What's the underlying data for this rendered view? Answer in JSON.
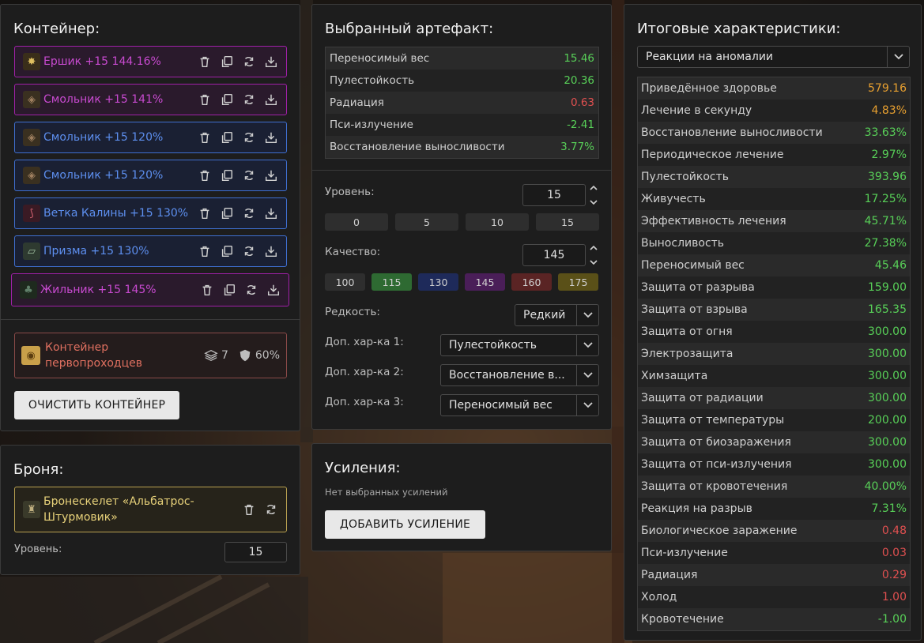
{
  "container": {
    "title": "Контейнер:",
    "items": [
      {
        "label": "Ершик +15 144.16%",
        "style": "purple",
        "icon": "spiky-artifact-icon"
      },
      {
        "label": "Смольник +15 141%",
        "style": "purple",
        "icon": "resin-artifact-icon"
      },
      {
        "label": "Смольник +15 120%",
        "style": "blue",
        "icon": "resin-artifact-icon"
      },
      {
        "label": "Смольник +15 120%",
        "style": "blue",
        "icon": "resin-artifact-icon"
      },
      {
        "label": "Ветка Калины +15 130%",
        "style": "blue",
        "icon": "branch-artifact-icon"
      },
      {
        "label": "Призма +15 130%",
        "style": "blue",
        "icon": "prism-artifact-icon"
      },
      {
        "label": "Жильник +15 145%",
        "style": "purple",
        "icon": "vein-artifact-icon"
      }
    ],
    "box": {
      "name": "Контейнер первопроходцев",
      "slots": "7",
      "protection": "60%"
    },
    "clear_button": "ОЧИСТИТЬ КОНТЕЙНЕР"
  },
  "armor": {
    "title": "Броня:",
    "name": "Бронескелет «Альбатрос-Штурмовик»",
    "level_label": "Уровень:",
    "level_value": "15"
  },
  "artifact": {
    "title": "Выбранный артефакт:",
    "stats": [
      {
        "name": "Переносимый вес",
        "value": "15.46",
        "color": "green"
      },
      {
        "name": "Пулестойкость",
        "value": "20.36",
        "color": "green"
      },
      {
        "name": "Радиация",
        "value": "0.63",
        "color": "red"
      },
      {
        "name": "Пси-излучение",
        "value": "-2.41",
        "color": "green"
      },
      {
        "name": "Восстановление выносливости",
        "value": "3.77%",
        "color": "green"
      }
    ],
    "level_label": "Уровень:",
    "level_value": "15",
    "level_presets": [
      "0",
      "5",
      "10",
      "15"
    ],
    "quality_label": "Качество:",
    "quality_value": "145",
    "quality_presets": [
      {
        "label": "100",
        "color": "#2e2e2e"
      },
      {
        "label": "115",
        "color": "#2e6a32"
      },
      {
        "label": "130",
        "color": "#1e2a5a"
      },
      {
        "label": "145",
        "color": "#4a1e58"
      },
      {
        "label": "160",
        "color": "#5a2424"
      },
      {
        "label": "175",
        "color": "#5a5018"
      }
    ],
    "rarity_label": "Редкость:",
    "rarity_value": "Редкий",
    "extra1_label": "Доп. хар-ка 1:",
    "extra1_value": "Пулестойкость",
    "extra2_label": "Доп. хар-ка 2:",
    "extra2_value": "Восстановление в...",
    "extra3_label": "Доп. хар-ка 3:",
    "extra3_value": "Переносимый вес"
  },
  "boosts": {
    "title": "Усиления:",
    "empty_text": "Нет выбранных усилений",
    "add_button": "ДОБАВИТЬ УСИЛЕНИЕ"
  },
  "totals": {
    "title": "Итоговые характеристики:",
    "filter_value": "Реакции на аномалии",
    "rows": [
      {
        "name": "Приведённое здоровье",
        "value": "579.16",
        "color": "orange"
      },
      {
        "name": "Лечение в секунду",
        "value": "4.83%",
        "color": "orange"
      },
      {
        "name": "Восстановление выносливости",
        "value": "33.63%",
        "color": "green"
      },
      {
        "name": "Периодическое лечение",
        "value": "2.97%",
        "color": "green"
      },
      {
        "name": "Пулестойкость",
        "value": "393.96",
        "color": "green"
      },
      {
        "name": "Живучесть",
        "value": "17.25%",
        "color": "green"
      },
      {
        "name": "Эффективность лечения",
        "value": "45.71%",
        "color": "green"
      },
      {
        "name": "Выносливость",
        "value": "27.38%",
        "color": "green"
      },
      {
        "name": "Переносимый вес",
        "value": "45.46",
        "color": "green"
      },
      {
        "name": "Защита от разрыва",
        "value": "159.00",
        "color": "green"
      },
      {
        "name": "Защита от взрыва",
        "value": "165.35",
        "color": "green"
      },
      {
        "name": "Защита от огня",
        "value": "300.00",
        "color": "green"
      },
      {
        "name": "Электрозащита",
        "value": "300.00",
        "color": "green"
      },
      {
        "name": "Химзащита",
        "value": "300.00",
        "color": "green"
      },
      {
        "name": "Защита от радиации",
        "value": "300.00",
        "color": "green"
      },
      {
        "name": "Защита от температуры",
        "value": "200.00",
        "color": "green"
      },
      {
        "name": "Защита от биозаражения",
        "value": "300.00",
        "color": "green"
      },
      {
        "name": "Защита от пси-излучения",
        "value": "300.00",
        "color": "green"
      },
      {
        "name": "Защита от кровотечения",
        "value": "40.00%",
        "color": "green"
      },
      {
        "name": "Реакция на разрыв",
        "value": "7.31%",
        "color": "green"
      },
      {
        "name": "Биологическое заражение",
        "value": "0.48",
        "color": "red"
      },
      {
        "name": "Пси-излучение",
        "value": "0.03",
        "color": "red"
      },
      {
        "name": "Радиация",
        "value": "0.29",
        "color": "red"
      },
      {
        "name": "Холод",
        "value": "1.00",
        "color": "red"
      },
      {
        "name": "Кровотечение",
        "value": "-1.00",
        "color": "green"
      }
    ]
  }
}
